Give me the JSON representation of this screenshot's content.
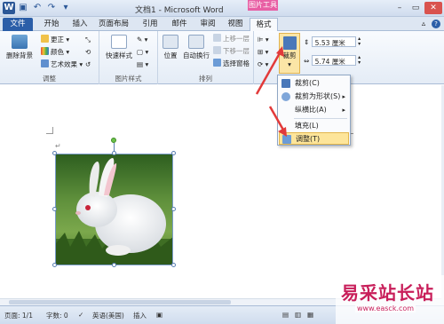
{
  "window": {
    "title": "文档1 - Microsoft Word",
    "context_tab_title": "图片工具",
    "logo": "W"
  },
  "tabs": [
    {
      "label": "文件"
    },
    {
      "label": "开始"
    },
    {
      "label": "插入"
    },
    {
      "label": "页面布局"
    },
    {
      "label": "引用"
    },
    {
      "label": "邮件"
    },
    {
      "label": "审阅"
    },
    {
      "label": "视图"
    },
    {
      "label": "格式"
    }
  ],
  "ribbon": {
    "adjust_group": {
      "label": "调整",
      "remove_bg": "删除背景",
      "corrections": "更正",
      "color": "颜色",
      "artistic": "艺术效果"
    },
    "styles_group": {
      "label": "图片样式",
      "quick_styles": "快速样式"
    },
    "arrange_group": {
      "label": "排列",
      "position": "位置",
      "wrap_text": "自动换行",
      "bring_forward": "上移一层",
      "send_backward": "下移一层",
      "selection_pane": "选择窗格"
    },
    "size_group": {
      "crop": "裁剪",
      "height_value": "5.53 厘米",
      "width_value": "5.74 厘米"
    }
  },
  "crop_menu": {
    "items": [
      {
        "label": "裁剪(C)"
      },
      {
        "label": "裁剪为形状(S)"
      },
      {
        "label": "纵横比(A)"
      },
      {
        "label": "填充(L)"
      },
      {
        "label": "调整(T)"
      }
    ]
  },
  "status": {
    "page": "页面: 1/1",
    "words": "字数: 0",
    "language": "英语(美国)",
    "mode": "插入"
  },
  "watermark": {
    "text": "易采站长站",
    "url": "www.easck.com"
  },
  "colors": {
    "file_tab": "#2b5ea8",
    "context_tab": "#e85fa4",
    "highlight": "#fde59a",
    "arrow": "#e23a3a"
  }
}
